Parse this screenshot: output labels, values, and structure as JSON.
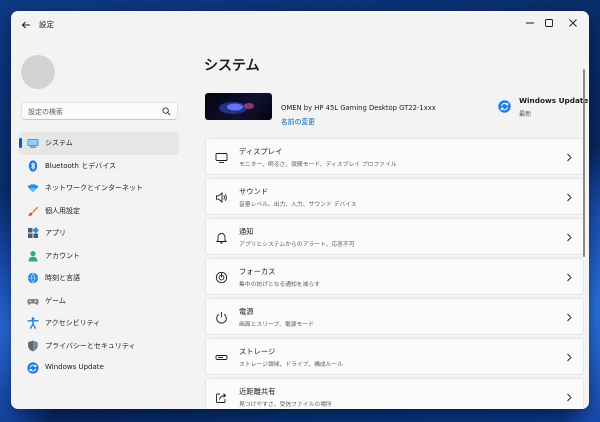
{
  "window": {
    "title": "設定"
  },
  "sidebar": {
    "search": {
      "placeholder": "設定の検索"
    },
    "items": [
      {
        "label": "システム",
        "icon": "system-icon",
        "selected": true
      },
      {
        "label": "Bluetooth とデバイス",
        "icon": "bluetooth-icon"
      },
      {
        "label": "ネットワークとインターネット",
        "icon": "network-icon"
      },
      {
        "label": "個人用設定",
        "icon": "personalization-brush-icon"
      },
      {
        "label": "アプリ",
        "icon": "apps-icon"
      },
      {
        "label": "アカウント",
        "icon": "account-icon"
      },
      {
        "label": "時刻と言語",
        "icon": "time-language-icon"
      },
      {
        "label": "ゲーム",
        "icon": "gaming-icon"
      },
      {
        "label": "アクセシビリティ",
        "icon": "accessibility-icon"
      },
      {
        "label": "プライバシーとセキュリティ",
        "icon": "privacy-shield-icon"
      },
      {
        "label": "Windows Update",
        "icon": "windows-update-icon"
      }
    ]
  },
  "main": {
    "title": "システム",
    "device": {
      "name": "OMEN by HP 45L Gaming Desktop GT22-1xxx",
      "rename": "名前の変更"
    },
    "windows_update": {
      "title": "Windows Update",
      "status": "最新"
    },
    "cards": [
      {
        "title": "ディスプレイ",
        "subtitle": "モニター、明るさ、夜間モード、ディスプレイ プロファイル",
        "icon": "display-icon"
      },
      {
        "title": "サウンド",
        "subtitle": "音量レベル、出力、入力、サウンド デバイス",
        "icon": "sound-icon"
      },
      {
        "title": "通知",
        "subtitle": "アプリとシステムからのアラート、応答不可",
        "icon": "notification-bell-icon"
      },
      {
        "title": "フォーカス",
        "subtitle": "集中の妨げとなる通知を減らす",
        "icon": "focus-icon"
      },
      {
        "title": "電源",
        "subtitle": "画面とスリープ、電源モード",
        "icon": "power-icon"
      },
      {
        "title": "ストレージ",
        "subtitle": "ストレージ領域、ドライブ、構成ルール",
        "icon": "storage-icon"
      },
      {
        "title": "近距離共有",
        "subtitle": "見つけやすさ、受信ファイルの場所",
        "icon": "nearby-share-icon"
      }
    ]
  },
  "colors": {
    "accent": "#005fb8",
    "window_bg": "#f3f3f3",
    "card_bg": "#fbfbfb"
  }
}
